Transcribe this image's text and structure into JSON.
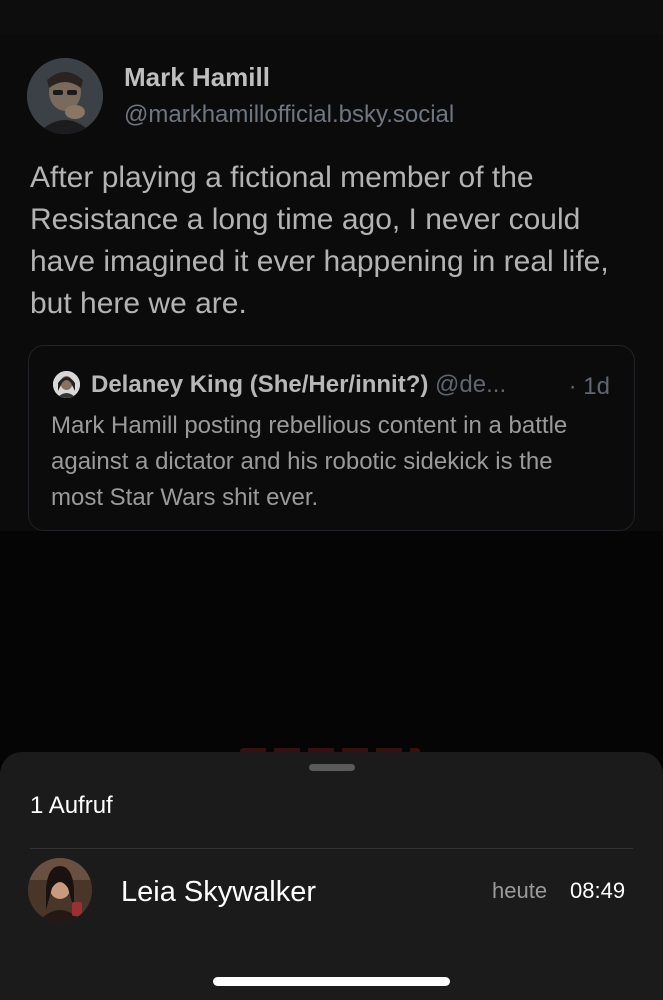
{
  "post": {
    "author": {
      "name": "Mark Hamill",
      "handle": "@markhamillofficial.bsky.social"
    },
    "text": "After playing a fictional member of the Resistance a long time ago, I never could have imagined it ever happening in real life, but here we are.",
    "quote": {
      "name": "Delaney King (She/Her/innit?)",
      "handle": "@de...",
      "time": "· 1d",
      "text": "Mark Hamill posting rebellious content in a battle against a dictator and his robotic sidekick is the most Star Wars shit ever."
    }
  },
  "sheet": {
    "title": "1 Aufruf",
    "viewers": [
      {
        "name": "Leia Skywalker",
        "day": "heute",
        "time": "08:49"
      }
    ]
  }
}
